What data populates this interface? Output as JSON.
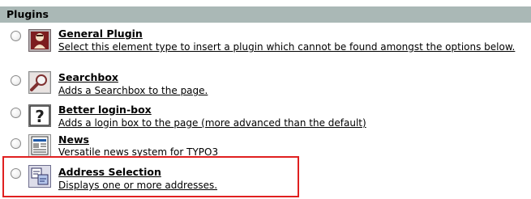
{
  "header": {
    "title": "Plugins"
  },
  "plugins": [
    {
      "title": "General Plugin",
      "description": "Select this element type to insert a plugin which cannot be found amongst the options below.",
      "icon": "general-plugin-icon"
    },
    {
      "title": "Searchbox",
      "description": "Adds a Searchbox to the page.",
      "icon": "search-icon"
    },
    {
      "title": "Better login-box",
      "description": "Adds a login box to the page (more advanced than the default)",
      "icon": "login-question-icon"
    },
    {
      "title": "News",
      "description": "Versatile news system for TYPO3",
      "icon": "news-icon"
    },
    {
      "title": "Address Selection",
      "description": "Displays one or more addresses.",
      "icon": "address-icon"
    }
  ],
  "colors": {
    "header_bg": "#aab8b6",
    "highlight": "#e02020"
  }
}
